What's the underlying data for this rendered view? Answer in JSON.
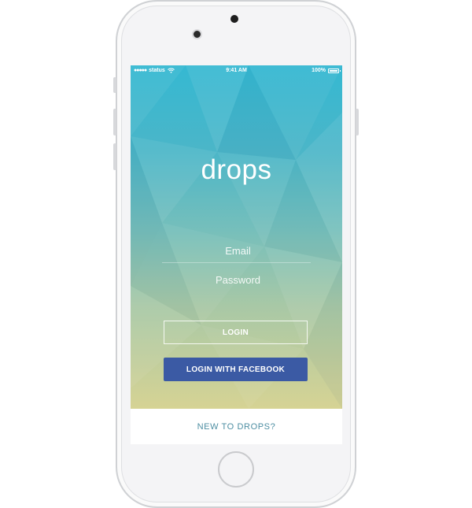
{
  "device": "iPhone",
  "status_bar": {
    "carrier_signal": "●●●●●",
    "carrier": "status",
    "time": "9:41 AM",
    "battery": "100%"
  },
  "app": {
    "logo": "drops",
    "email_placeholder": "Email",
    "password_placeholder": "Password",
    "login_label": "LOGIN",
    "facebook_label": "LOGIN WITH FACEBOOK",
    "signup_link": "NEW TO DROPS?"
  },
  "colors": {
    "gradient_top": "#35b8d2",
    "gradient_bottom": "#d6d394",
    "facebook_button": "#3b5aa4",
    "link_text": "#4d8ea2"
  },
  "icons": [
    "wifi-icon",
    "battery-icon",
    "drop-icon"
  ]
}
